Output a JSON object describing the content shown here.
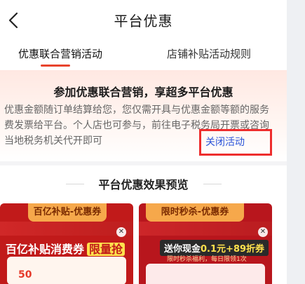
{
  "nav": {
    "title": "平台优惠",
    "back_icon": "chevron-left-icon"
  },
  "tabs": [
    {
      "label": "优惠联合营销活动",
      "active": true
    },
    {
      "label": "店铺补贴活动规则",
      "active": false
    }
  ],
  "hero": {
    "title": "参加优惠联合营销，享超多平台优惠",
    "description": "优惠金额随订单结算给您，您仅需开具与优惠金额等额的服务费发票给平台。个人店也可参与，前往电子税务局开票或咨询当地税务机关代开即可",
    "close_link": "关闭活动"
  },
  "preview": {
    "title": "平台优惠效果预览",
    "cards": [
      {
        "pill": "百亿补贴-优惠券",
        "banner": "百亿补贴消费券",
        "banner_highlight": "限量抢",
        "sub": "",
        "mini": "",
        "amount": "50"
      },
      {
        "pill": "限时秒杀-优惠券",
        "banner": "送你现金",
        "banner_highlight": "0.1元+89折券",
        "sub": "限时秒杀福利，每日限领1次",
        "mini": "",
        "amount": ""
      }
    ]
  },
  "colors": {
    "accent": "#e8432c",
    "link": "#2b54d9",
    "highlight_box": "#ee2d2d"
  }
}
